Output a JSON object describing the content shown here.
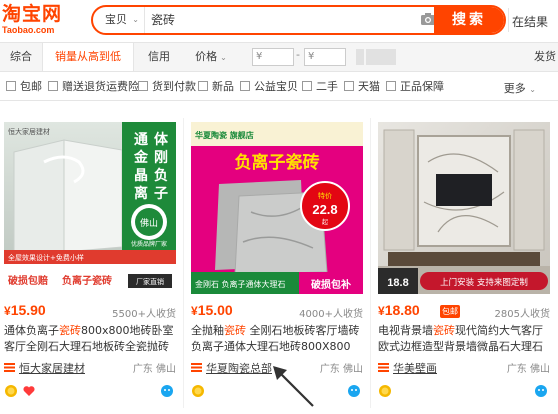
{
  "logo": {
    "main": "淘宝网",
    "sub": "Taobao.com"
  },
  "search": {
    "scope": "宝贝",
    "query": "瓷砖",
    "button": "搜索",
    "in_results": "在结果"
  },
  "sortbar": {
    "items": [
      "综合",
      "销量从高到低",
      "信用"
    ],
    "price_label": "价格",
    "price_min": "¥",
    "price_max": "¥",
    "price_dash": "-",
    "right": "发货"
  },
  "filters": [
    "包邮",
    "赠送退货运费险",
    "货到付款",
    "新品",
    "公益宝贝",
    "二手",
    "天猫",
    "正品保障"
  ],
  "more": "更多",
  "products": [
    {
      "price": "15.90",
      "yen": "¥",
      "sold": "5500+人收货",
      "title_pre": "通体负离子",
      "title_hl": "瓷砖",
      "title_post": "800x800地砖卧室客厅全刚石大理石地板砖全瓷抛砖",
      "shop": "恒大家居建材",
      "location": "广东 佛山",
      "img": {
        "brand_top": "恒大家居建材",
        "side_text": "通体金刚晶负离子",
        "badge_city": "佛山",
        "badge_sub": "优质品牌厂家",
        "banner1": "全屋效果设计+免费小样",
        "banner2": "破损包赔",
        "banner3": "负离子瓷砖",
        "banner4": "厂家直销"
      }
    },
    {
      "price": "15.00",
      "yen": "¥",
      "sold": "4000+人收货",
      "title_pre": "全抛釉",
      "title_hl": "瓷砖",
      "title_post": " 全刚石地板砖客厅墙砖 负离子通体大理石地砖800X800",
      "shop": "华夏陶瓷总部",
      "location": "广东 佛山",
      "img": {
        "brand_top": "华夏陶瓷 旗舰店",
        "headline": "负离子瓷砖",
        "circle_top": "特价",
        "circle_price": "22.8",
        "circle_unit": "起",
        "banner1": "金刚石 负离子通体大理石",
        "banner2": "破损包补"
      }
    },
    {
      "price": "18.80",
      "yen": "¥",
      "baoyou": "包邮",
      "sold": "2805人收货",
      "title_pre": "电视背景墙",
      "title_hl": "瓷砖",
      "title_post": "现代简约大气客厅欧式边框造型背景墙微晶石大理石",
      "shop": "华美壁画",
      "location": "广东 佛山",
      "img": {
        "price_badge": "18.8",
        "banner": "上门安装 支持来图定制"
      }
    }
  ],
  "colors": {
    "accent": "#ff4400",
    "pink": "#e4007f",
    "green": "#1a8a3a"
  }
}
